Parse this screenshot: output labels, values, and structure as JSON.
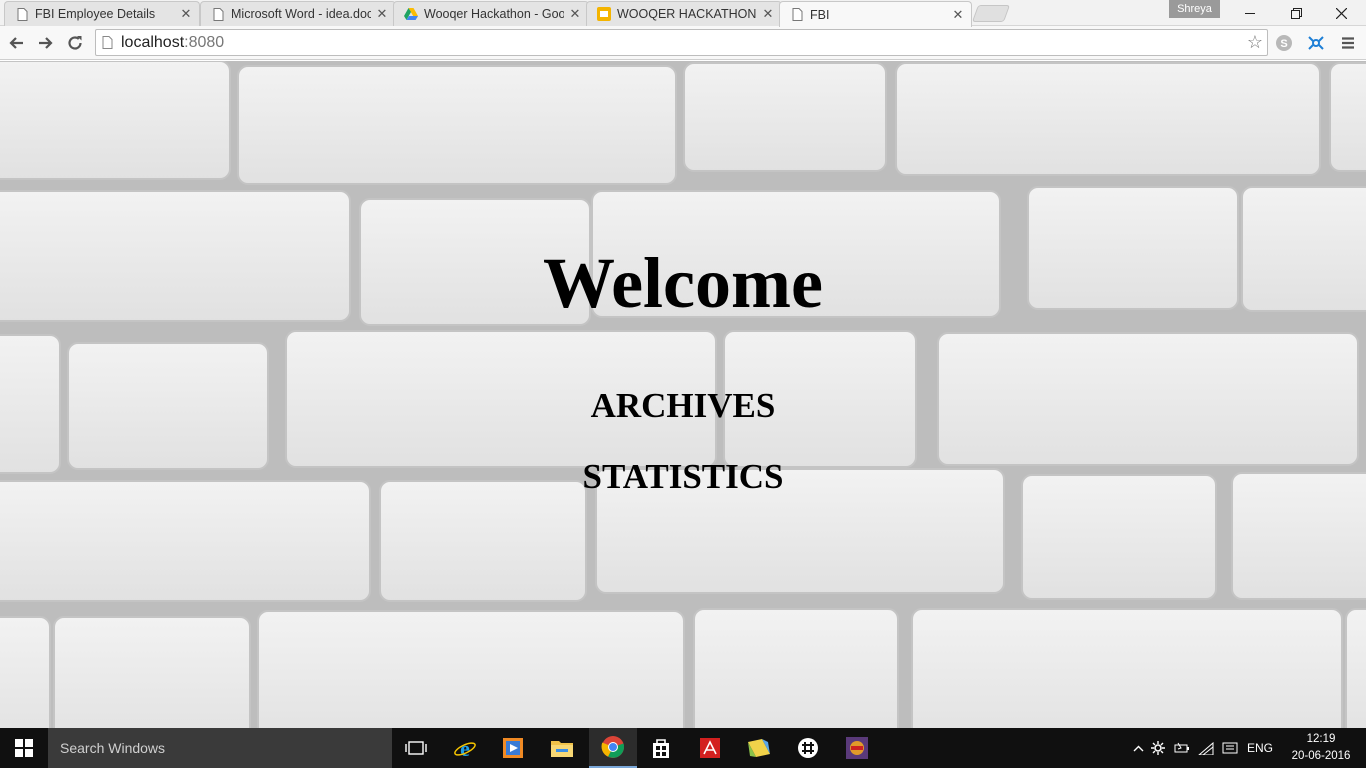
{
  "browser": {
    "tabs": [
      {
        "title": "FBI Employee Details",
        "favicon": "page-icon"
      },
      {
        "title": "Microsoft Word - idea.doc",
        "favicon": "page-icon"
      },
      {
        "title": "Wooqer Hackathon - Goo",
        "favicon": "drive-icon"
      },
      {
        "title": "WOOQER HACKATHON - ",
        "favicon": "slides-icon"
      },
      {
        "title": "FBI",
        "favicon": "page-icon",
        "active": true
      }
    ],
    "profile_name": "Shreya",
    "url_host": "localhost",
    "url_port": ":8080"
  },
  "page": {
    "heading": "Welcome",
    "links": {
      "archives": "ARCHIVES",
      "statistics": "STATISTICS"
    }
  },
  "taskbar": {
    "search_placeholder": "Search Windows",
    "language": "ENG",
    "time": "12:19",
    "date": "20-06-2016"
  },
  "colors": {
    "taskbar_bg": "#101010",
    "search_bg": "#3a3a3a",
    "chrome_active_underline": "#7aa7d8"
  }
}
